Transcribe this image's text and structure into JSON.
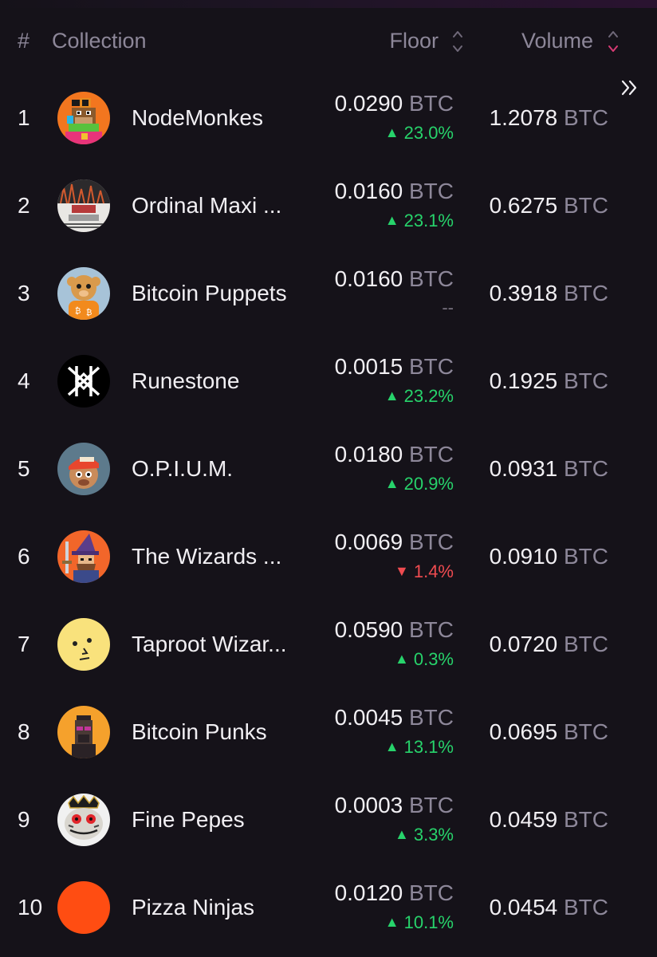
{
  "header": {
    "rank_label": "#",
    "collection_label": "Collection",
    "floor_label": "Floor",
    "volume_label": "Volume"
  },
  "rows": [
    {
      "rank": "1",
      "name": "NodeMonkes",
      "floor": "0.0290",
      "floor_unit": "BTC",
      "change": "23.0%",
      "direction": "up",
      "volume": "1.2078",
      "volume_unit": "BTC",
      "avatar": "nodemonkes-avatar"
    },
    {
      "rank": "2",
      "name": "Ordinal Maxi ...",
      "floor": "0.0160",
      "floor_unit": "BTC",
      "change": "23.1%",
      "direction": "up",
      "volume": "0.6275",
      "volume_unit": "BTC",
      "avatar": "ordinal-maxi-avatar"
    },
    {
      "rank": "3",
      "name": "Bitcoin Puppets",
      "floor": "0.0160",
      "floor_unit": "BTC",
      "change": "--",
      "direction": "flat",
      "volume": "0.3918",
      "volume_unit": "BTC",
      "avatar": "bitcoin-puppets-avatar"
    },
    {
      "rank": "4",
      "name": "Runestone",
      "floor": "0.0015",
      "floor_unit": "BTC",
      "change": "23.2%",
      "direction": "up",
      "volume": "0.1925",
      "volume_unit": "BTC",
      "avatar": "runestone-avatar"
    },
    {
      "rank": "5",
      "name": "O.P.I.U.M.",
      "floor": "0.0180",
      "floor_unit": "BTC",
      "change": "20.9%",
      "direction": "up",
      "volume": "0.0931",
      "volume_unit": "BTC",
      "avatar": "opium-avatar"
    },
    {
      "rank": "6",
      "name": "The Wizards ...",
      "floor": "0.0069",
      "floor_unit": "BTC",
      "change": "1.4%",
      "direction": "down",
      "volume": "0.0910",
      "volume_unit": "BTC",
      "avatar": "wizards-avatar"
    },
    {
      "rank": "7",
      "name": "Taproot Wizar...",
      "floor": "0.0590",
      "floor_unit": "BTC",
      "change": "0.3%",
      "direction": "up",
      "volume": "0.0720",
      "volume_unit": "BTC",
      "avatar": "taproot-wizards-avatar"
    },
    {
      "rank": "8",
      "name": "Bitcoin Punks",
      "floor": "0.0045",
      "floor_unit": "BTC",
      "change": "13.1%",
      "direction": "up",
      "volume": "0.0695",
      "volume_unit": "BTC",
      "avatar": "bitcoin-punks-avatar"
    },
    {
      "rank": "9",
      "name": "Fine Pepes",
      "floor": "0.0003",
      "floor_unit": "BTC",
      "change": "3.3%",
      "direction": "up",
      "volume": "0.0459",
      "volume_unit": "BTC",
      "avatar": "fine-pepes-avatar"
    },
    {
      "rank": "10",
      "name": "Pizza Ninjas",
      "floor": "0.0120",
      "floor_unit": "BTC",
      "change": "10.1%",
      "direction": "up",
      "volume": "0.0454",
      "volume_unit": "BTC",
      "avatar": "pizza-ninjas-avatar"
    }
  ],
  "icons": {
    "sort": "sort-icon",
    "expand": "double-chevron-right-icon",
    "up": "triangle-up-icon",
    "down": "triangle-down-icon"
  },
  "colors": {
    "background": "#151219",
    "text": "#f1eff3",
    "muted": "#8d8799",
    "up": "#27d36b",
    "down": "#ef4b50",
    "sort_active": "#d83b74"
  }
}
